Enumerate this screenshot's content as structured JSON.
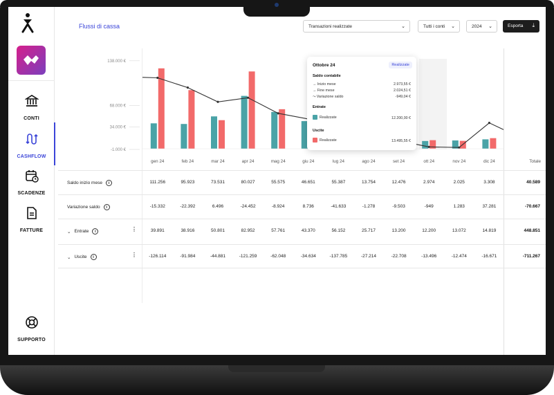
{
  "sidebar": {
    "nav": [
      {
        "label": "CONTI",
        "icon": "bank-icon"
      },
      {
        "label": "CASHFLOW",
        "icon": "cashflow-icon"
      },
      {
        "label": "SCADENZE",
        "icon": "calendar-icon"
      },
      {
        "label": "FATTURE",
        "icon": "invoice-icon"
      }
    ],
    "support": {
      "label": "SUPPORTO",
      "icon": "lifebuoy-icon"
    }
  },
  "header": {
    "title": "Flussi di cassa",
    "filter_transactions": "Transazioni realizzate",
    "filter_accounts": "Tutti i conti",
    "filter_year": "2024",
    "export_label": "Esporta"
  },
  "chart_data": {
    "type": "bar",
    "categories": [
      "gen 24",
      "feb 24",
      "mar 24",
      "apr 24",
      "mag 24",
      "giu 24",
      "lug 24",
      "ago 24",
      "set 24",
      "ott 24",
      "nov 24",
      "dic 24"
    ],
    "y_ticks": [
      "138.000 €",
      "68.000 €",
      "34.000 €",
      "-1.000 €"
    ],
    "series": [
      {
        "values": [
          39891,
          38916,
          50801,
          82952,
          57761,
          43370,
          56152,
          25717,
          13200,
          12200,
          13072,
          14819
        ],
        "color": "#4aa3a7"
      },
      {
        "values": [
          126114,
          91984,
          44881,
          121259,
          62048,
          34634,
          137785,
          27214,
          22708,
          13496,
          12474,
          16671
        ],
        "color": "#f26a6a"
      }
    ],
    "line": {
      "values": [
        111256,
        95923,
        73531,
        80027,
        55575,
        46651,
        55387,
        13754,
        12476,
        2974,
        2025,
        40589
      ],
      "color": "#333333"
    },
    "ylim": [
      -1000,
      140000
    ],
    "total_label": "Totale"
  },
  "tooltip": {
    "title": "Ottobre 24",
    "pill": "Realizzate",
    "section_balance": "Saldo contabile",
    "lines": [
      {
        "label": "Inizio mese",
        "value": "2.973,55 €"
      },
      {
        "label": "Fine mese",
        "value": "2.024,51 €"
      },
      {
        "label": "Variazione saldo",
        "value": "-949,04 €"
      }
    ],
    "section_in": "Entrate",
    "in_label": "Realizzate",
    "in_value": "12.200,00 €",
    "section_out": "Uscite",
    "out_label": "Realizzate",
    "out_value": "13.495,55 €"
  },
  "table": {
    "rows": [
      {
        "label": "Saldo inizio mese",
        "values": [
          "111.256",
          "95.923",
          "73.531",
          "80.027",
          "55.575",
          "46.651",
          "55.387",
          "13.754",
          "12.476",
          "2.974",
          "2.025",
          "3.308"
        ],
        "total": "40.589"
      },
      {
        "label": "Variazione saldo",
        "values": [
          "-15.332",
          "-22.392",
          "6.496",
          "-24.452",
          "-8.924",
          "8.736",
          "-41.633",
          "-1.278",
          "-9.503",
          "-949",
          "1.283",
          "37.281"
        ],
        "total": "-70.667"
      },
      {
        "label": "Entrate",
        "values": [
          "39.891",
          "38.916",
          "50.801",
          "82.952",
          "57.761",
          "43.370",
          "56.152",
          "25.717",
          "13.200",
          "12.200",
          "13.072",
          "14.819"
        ],
        "total": "448.851"
      },
      {
        "label": "Uscite",
        "values": [
          "-126.114",
          "-91.984",
          "-44.881",
          "-121.259",
          "-62.048",
          "-34.634",
          "-137.785",
          "-27.214",
          "-22.708",
          "-13.496",
          "-12.474",
          "-16.671"
        ],
        "total": "-711.267"
      }
    ]
  }
}
